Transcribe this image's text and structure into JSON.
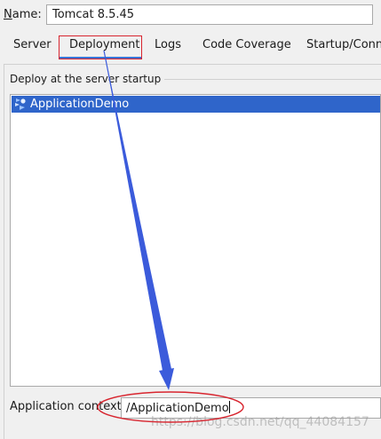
{
  "name_row": {
    "label": "Name:",
    "mnemonic": "N",
    "label_rest": "ame:",
    "value": "Tomcat 8.5.45"
  },
  "tabs": [
    {
      "label": "Server"
    },
    {
      "label": "Deployment",
      "selected": true
    },
    {
      "label": "Logs"
    },
    {
      "label": "Code Coverage"
    },
    {
      "label": "Startup/Conne"
    }
  ],
  "deploy": {
    "title": "Deploy at the server startup",
    "items": [
      {
        "label": "ApplicationDemo",
        "icon": "artifact-icon",
        "selected": true
      }
    ]
  },
  "context": {
    "label": "Application context:",
    "value": "/ApplicationDemo"
  },
  "watermark": "https://blog.csdn.net/qq_44084157",
  "colors": {
    "selection": "#2f65ca",
    "tab_underline": "#3875d7",
    "annotation_red": "#d8252f",
    "annotation_arrow": "#3b5bdb"
  }
}
